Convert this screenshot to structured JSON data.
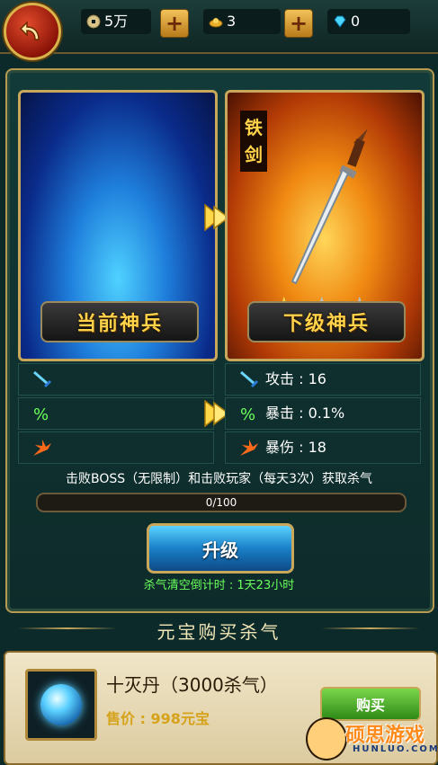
{
  "top_bar": {
    "coins": "5万",
    "ingots": "3",
    "diamonds": "0"
  },
  "cards": {
    "current_label": "当前神兵",
    "next_label": "下级神兵",
    "next_weapon_name": "铁剑",
    "stars_filled": 1,
    "stars_total": 3
  },
  "stats": {
    "attack": "攻击 : 16",
    "crit": "暴击 : 0.1%",
    "crit_damage": "暴伤 : 18"
  },
  "info_text": "击败BOSS（无限制）和击败玩家（每天3次）获取杀气",
  "progress": {
    "text": "0/100",
    "fraction": 0
  },
  "upgrade_label": "升级",
  "timer_text": "杀气清空倒计时 : 1天23小时",
  "shop": {
    "section_title": "元宝购买杀气",
    "item_name": "十灭丹（3000杀气）",
    "item_price": "售价 : 998元宝",
    "buy_label": "购买"
  },
  "watermark": {
    "title": "硕思游戏",
    "sub": "HUNLUO.COM"
  },
  "colors": {
    "gold": "#c9a75a",
    "timer_green": "#6aff5a",
    "price": "#d6a21a"
  }
}
